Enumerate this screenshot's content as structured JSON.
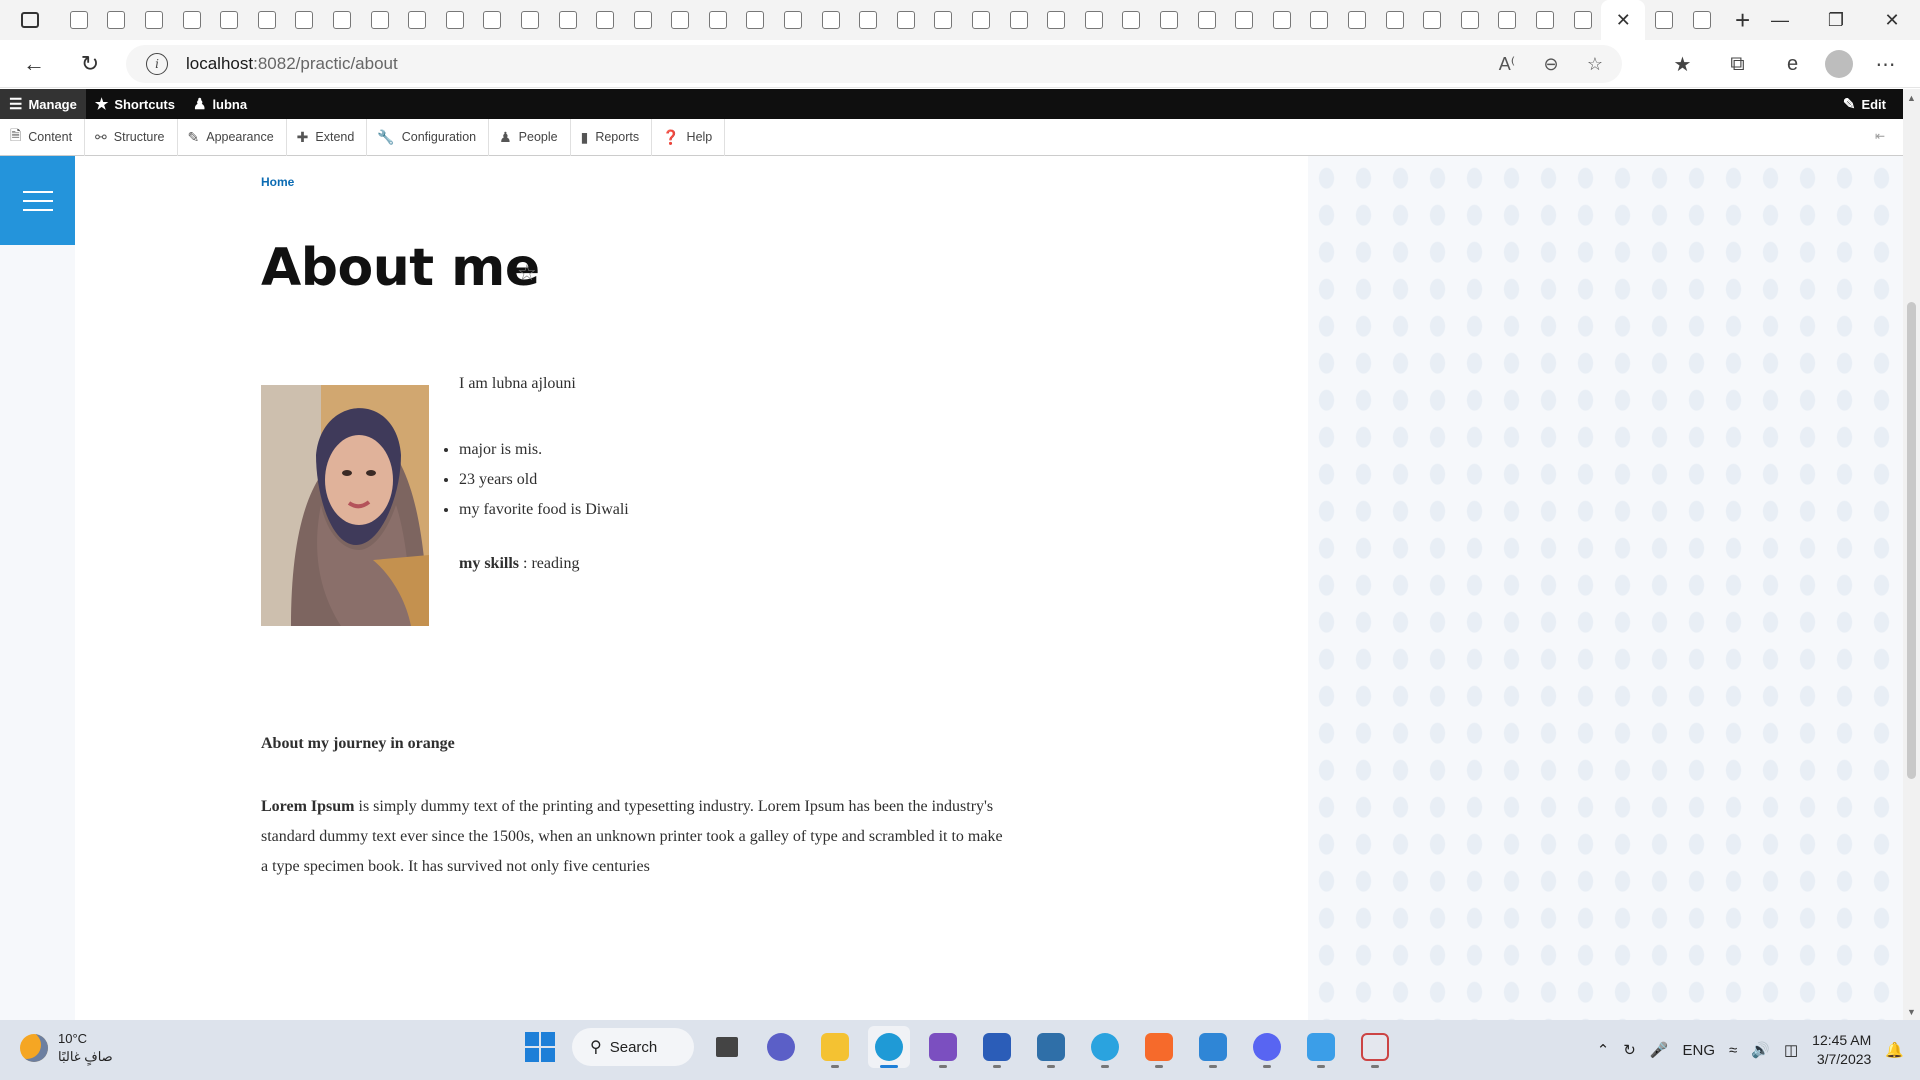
{
  "browser": {
    "url_host": "localhost",
    "url_path": ":8082/practic/about",
    "active_tab_close": "✕",
    "new_tab": "+"
  },
  "toolbar": {
    "manage": "Manage",
    "shortcuts": "Shortcuts",
    "user": "lubna",
    "edit": "Edit"
  },
  "tray_menu": [
    {
      "label": "Content",
      "icon": "content-icon"
    },
    {
      "label": "Structure",
      "icon": "structure-icon"
    },
    {
      "label": "Appearance",
      "icon": "appearance-icon"
    },
    {
      "label": "Extend",
      "icon": "extend-icon"
    },
    {
      "label": "Configuration",
      "icon": "configuration-icon"
    },
    {
      "label": "People",
      "icon": "people-icon"
    },
    {
      "label": "Reports",
      "icon": "reports-icon"
    },
    {
      "label": "Help",
      "icon": "help-icon"
    }
  ],
  "page": {
    "breadcrumb": "Home",
    "title": "About me",
    "intro": "I am lubna ajlouni",
    "facts": [
      "major is mis.",
      "23 years old",
      "my favorite food is Diwali"
    ],
    "skills_label": "my skills",
    "skills_value": " : reading",
    "journey_title": "About my journey in orange",
    "journey_lead": "Lorem Ipsum",
    "journey_body": " is simply dummy text of the printing and typesetting industry. Lorem Ipsum has been the industry's standard dummy text ever since the 1500s, when an unknown printer took a galley of type and scrambled it to make a type specimen book. It has survived not only five centuries"
  },
  "taskbar": {
    "temperature": "10°C",
    "weather_desc": "صافٍ غالبًا",
    "search_label": "Search",
    "language": "ENG",
    "time": "12:45 AM",
    "date": "3/7/2023"
  },
  "colors": {
    "accent": "#2494db",
    "toolbar_bg": "#0f0f0f",
    "link": "#0b6bb3"
  }
}
